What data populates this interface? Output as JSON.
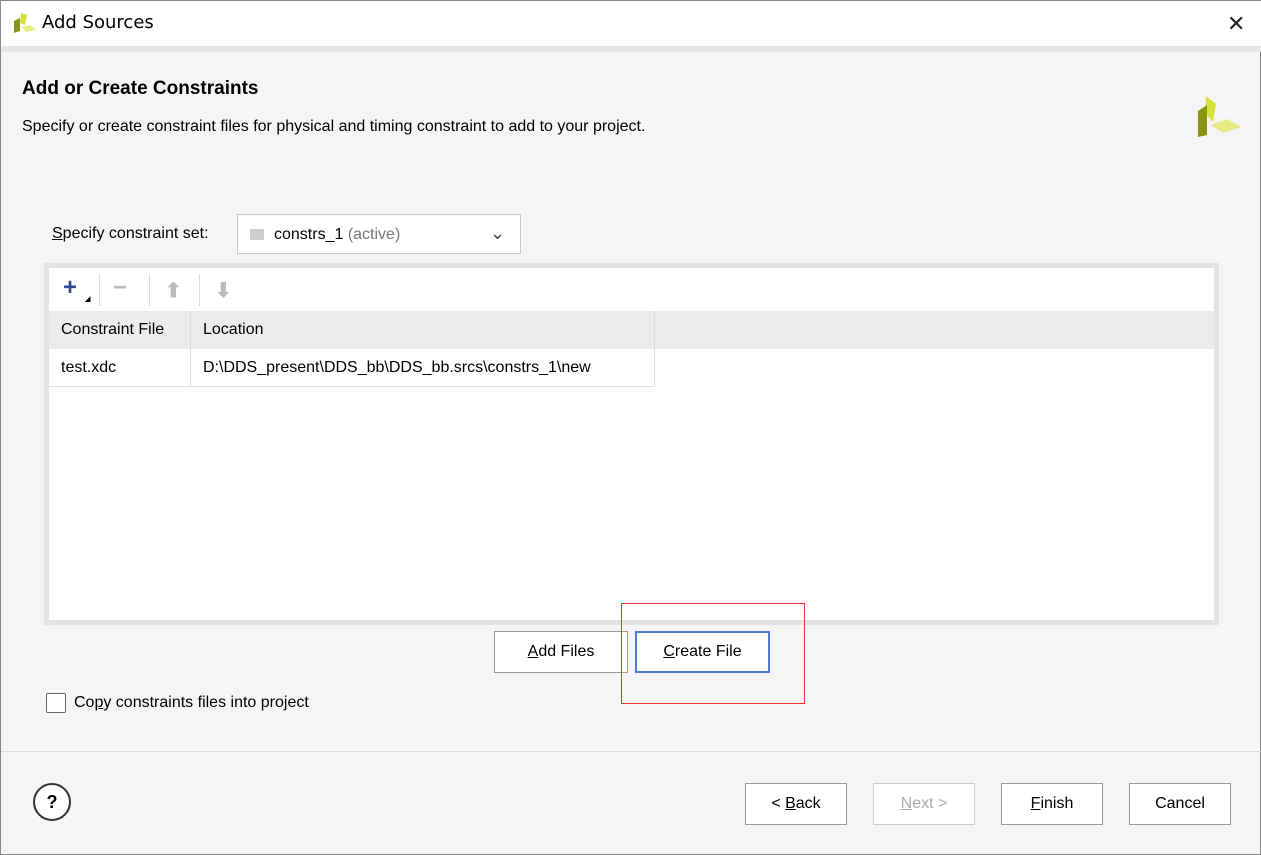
{
  "window": {
    "title": "Add Sources",
    "close_icon": "close-icon"
  },
  "header": {
    "title": "Add or Create Constraints",
    "subtitle": "Specify or create constraint files for physical and timing constraint to add to your project."
  },
  "constraint_set": {
    "label_mnemonic": "S",
    "label_rest": "pecify constraint set:",
    "value": "constrs_1",
    "status": "(active)"
  },
  "toolbar": {
    "icons": [
      "plus-icon",
      "minus-icon",
      "arrow-up-icon",
      "arrow-down-icon"
    ]
  },
  "table": {
    "columns": [
      "Constraint File",
      "Location"
    ],
    "rows": [
      {
        "file": "test.xdc",
        "location": "D:\\DDS_present\\DDS_bb\\DDS_bb.srcs\\constrs_1\\new"
      }
    ]
  },
  "buttons": {
    "add_files_m": "A",
    "add_files_r": "dd Files",
    "create_file_m": "C",
    "create_file_r": "reate File",
    "back_a": "< ",
    "back_m": "B",
    "back_r": "ack",
    "next_m": "N",
    "next_r": "ext >",
    "finish_m": "F",
    "finish_r": "inish",
    "cancel": "Cancel",
    "help": "?"
  },
  "copy": {
    "label_a": "Co",
    "label_m": "p",
    "label_r": "y constraints files into project",
    "checked": false
  },
  "colors": {
    "accent": "#4a7bd0",
    "highlight": "#e33333",
    "logo": [
      "#d8e040",
      "#8a9410",
      "#e6ec80"
    ]
  }
}
